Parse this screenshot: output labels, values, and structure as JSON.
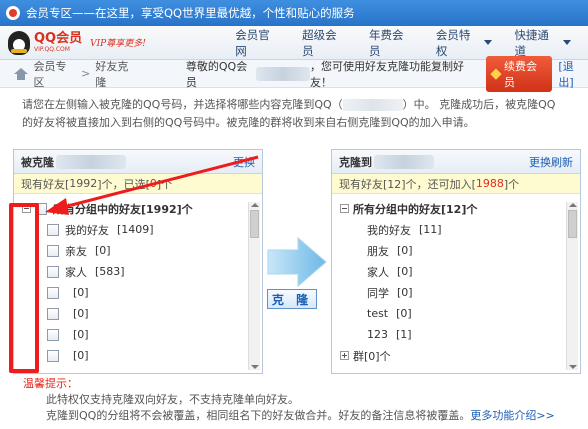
{
  "window": {
    "title": "会员专区——在这里，享受QQ世界里最优越，个性和贴心的服务"
  },
  "logo": {
    "brand": "QQ会员",
    "domain": "VIP.QQ.COM",
    "slogan": "VIP尊享更多!"
  },
  "nav": {
    "items": [
      "会员官网",
      "超级会员",
      "年费会员",
      "会员特权",
      "快捷通道"
    ]
  },
  "breadcrumb": {
    "home": "会员专区",
    "current": "好友克隆"
  },
  "greeting": {
    "prefix": "尊敬的QQ会员",
    "suffix": "，您可使用好友克隆功能复制好友！",
    "renew_label": "续费会员",
    "logout_label": "[退出]"
  },
  "instructions": {
    "line1_a": "请您在左侧输入被克隆的QQ号码，并选择将哪些内容克隆到QQ（",
    "line1_b": "）中。 克隆成功后，被克隆QQ",
    "line2": "的好友将被直接加入到右侧的QQ号码中。被克隆的群将收到来自右侧克隆到QQ的加入申请。"
  },
  "left_panel": {
    "title": "被克隆",
    "action": "更换",
    "count_a": "现有好友[",
    "count_num": "1992",
    "count_b": "]个，已选[",
    "selected_num": "0",
    "count_c": "]个",
    "root_label": "所有分组中的好友[1992]个",
    "groups": [
      {
        "name": "我的好友",
        "count": "[1409]"
      },
      {
        "name": "亲友",
        "count": "[0]"
      },
      {
        "name": "家人",
        "count": "[583]"
      },
      {
        "name": "",
        "count": "[0]"
      },
      {
        "name": "",
        "count": "[0]"
      },
      {
        "name": "",
        "count": "[0]"
      },
      {
        "name": "",
        "count": "[0]"
      }
    ]
  },
  "right_panel": {
    "title": "克隆到",
    "action": "更换刷新",
    "count_a": "现有好友[12]个，还可加入[",
    "count_num": "1988",
    "count_b": "]个",
    "root_label": "所有分组中的好友[12]个",
    "groups": [
      {
        "name": "我的好友",
        "count": "[11]"
      },
      {
        "name": "朋友",
        "count": "[0]"
      },
      {
        "name": "家人",
        "count": "[0]"
      },
      {
        "name": "同学",
        "count": "[0]"
      },
      {
        "name": "test",
        "count": "[0]"
      },
      {
        "name": "123",
        "count": "[1]"
      }
    ],
    "next_root": "群[0]个"
  },
  "clone_button": "克 隆",
  "tips": {
    "title": "温馨提示：",
    "line1": "此特权仅支持克隆双向好友，不支持克隆单向好友。",
    "line2": "克隆到QQ的分组将不会被覆盖，相同组名下的好友做合并。好友的备注信息将被覆盖。",
    "more": "更多功能介绍>>"
  },
  "colors": {
    "titlebar": "#2f7fd6",
    "highlight_red": "#ee1c1c",
    "count_red": "#e4281e",
    "link_blue": "#1b5eb3",
    "arrow_blue": "#7ec3ec"
  },
  "icons": {
    "home": "home-icon",
    "title_logo": "qq-icon",
    "logo": "penguin-icon"
  }
}
